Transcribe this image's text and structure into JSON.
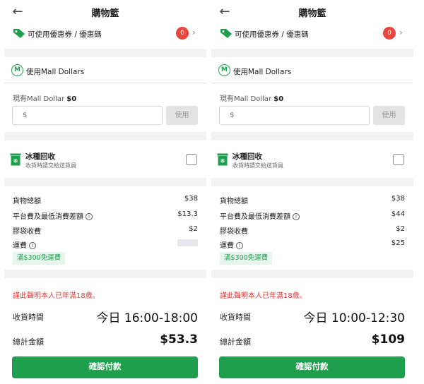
{
  "screens": [
    {
      "title": "購物籃",
      "coupon_label": "可使用優惠券 / 優惠碼",
      "coupon_count": "0",
      "mall_dollars_label": "使用Mall Dollars",
      "balance_prefix": "現有Mall Dollar",
      "balance_value": "$0",
      "dollar_placeholder": "$",
      "use_label": "使用",
      "ice_title": "冰種回收",
      "ice_subtitle": "收貨時請交給送貨員",
      "lines": {
        "subtotal_label": "貨物總額",
        "subtotal_value": "$38",
        "platform_label": "平台費及最低消費差額",
        "platform_value": "$13.3",
        "bag_label": "膠袋收費",
        "bag_value": "$2",
        "shipping_label": "運費",
        "shipping_value": ""
      },
      "free_shipping": "滿$300免運費",
      "age_warning": "謹此聲明本人已年滿18歲。",
      "delivery_label": "收貨時間",
      "delivery_time": "今日 16:00-18:00",
      "total_label": "總計金額",
      "total_value": "$53.3",
      "confirm_label": "確認付款"
    },
    {
      "title": "購物籃",
      "coupon_label": "可使用優惠券 / 優惠碼",
      "coupon_count": "0",
      "mall_dollars_label": "使用Mall Dollars",
      "balance_prefix": "現有Mall Dollar",
      "balance_value": "$0",
      "dollar_placeholder": "$",
      "use_label": "使用",
      "ice_title": "冰種回收",
      "ice_subtitle": "收貨時請交給送貨員",
      "lines": {
        "subtotal_label": "貨物總額",
        "subtotal_value": "$38",
        "platform_label": "平台費及最低消費差額",
        "platform_value": "$44",
        "bag_label": "膠袋收費",
        "bag_value": "$2",
        "shipping_label": "運費",
        "shipping_value": "$25"
      },
      "free_shipping": "滿$300免運費",
      "age_warning": "謹此聲明本人已年滿18歲。",
      "delivery_label": "收貨時間",
      "delivery_time": "今日 10:00-12:30",
      "total_label": "總計金額",
      "total_value": "$109",
      "confirm_label": "確認付款"
    }
  ],
  "icons": {
    "back": "arrow-left-icon",
    "coupon": "tag-icon",
    "chevron": "chevron-right-icon",
    "mall_dollars": "mall-dollars-m-icon",
    "ice": "ice-box-icon",
    "info": "info-icon"
  },
  "colors": {
    "accent_green": "#1f9f4e",
    "badge_red": "#e8453c",
    "warning_red": "#e53935",
    "disabled_gray": "#e3e3e3"
  }
}
